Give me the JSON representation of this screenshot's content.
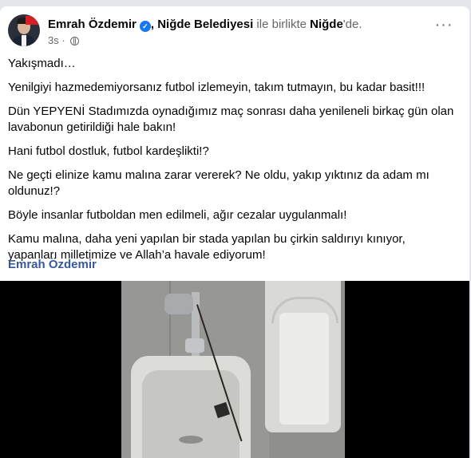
{
  "post": {
    "author": "Emrah Özdemir",
    "separator": ", ",
    "page": "Niğde Belediyesi",
    "with_text": " ile birlikte ",
    "location": "Niğde",
    "location_suffix": "'de.",
    "time": "3s",
    "time_dot": " · ",
    "more_label": "···",
    "paragraphs": [
      "Yakışmadı…",
      "Yenilgiyi hazmedemiyorsanız futbol izlemeyin, takım tutmayın, bu kadar basit!!!",
      "Dün YEPYENİ Stadımızda oynadığımız maç sonrası daha yenileneli birkaç gün olan lavabonun getirildiği hale bakın!",
      "Hani futbol dostluk, futbol kardeşlikti!?",
      "Ne geçti elinize kamu malına zarar vererek? Ne oldu, yakıp yıktınız da adam mı oldunuz!?",
      "Böyle insanlar futboldan men edilmeli, ağır cezalar uygulanmalı!",
      "Kamu malına, daha yeni yapılan bir stada yapılan bu çirkin saldırıyı kınıyor, yapanları milletimize ve Allah’a havale ediyorum!"
    ],
    "signature": "Emrah Özdemir"
  },
  "colors": {
    "verified": "#1877f2",
    "signature": "#385898",
    "muted": "#65676b"
  },
  "icons": {
    "verified": "verified-badge-icon",
    "privacy": "globe-icon",
    "more": "more-options-icon"
  }
}
